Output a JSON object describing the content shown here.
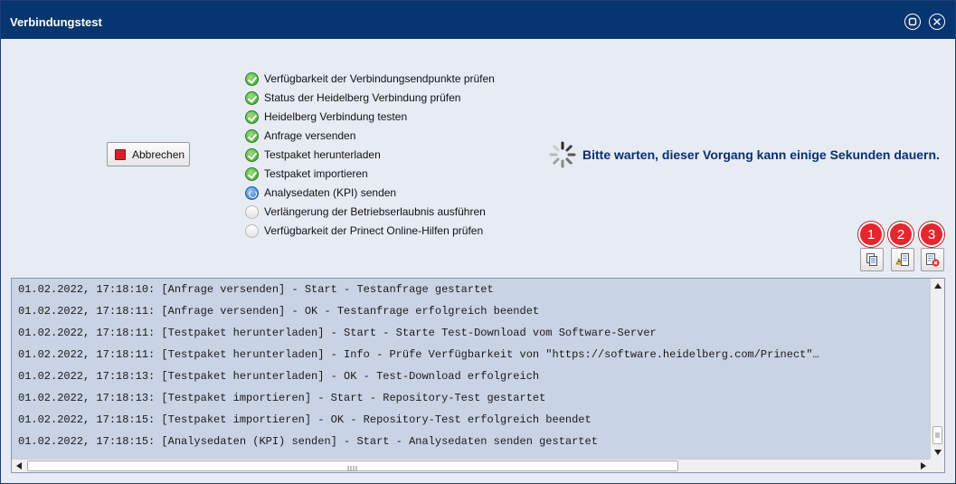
{
  "window": {
    "title": "Verbindungstest"
  },
  "cancel_button": {
    "label": "Abbrechen"
  },
  "steps": [
    {
      "label": "Verfügbarkeit der Verbindungsendpunkte prüfen",
      "status": "done"
    },
    {
      "label": "Status der Heidelberg Verbindung prüfen",
      "status": "done"
    },
    {
      "label": "Heidelberg Verbindung testen",
      "status": "done"
    },
    {
      "label": "Anfrage versenden",
      "status": "done"
    },
    {
      "label": "Testpaket herunterladen",
      "status": "done"
    },
    {
      "label": "Testpaket importieren",
      "status": "done"
    },
    {
      "label": "Analysedaten (KPI) senden",
      "status": "running"
    },
    {
      "label": "Verlängerung der Betriebserlaubnis ausführen",
      "status": "pending"
    },
    {
      "label": "Verfügbarkeit der Prinect Online-Hilfen prüfen",
      "status": "pending"
    }
  ],
  "wait_message": "Bitte warten, dieser Vorgang kann einige Sekunden dauern.",
  "badges": [
    "1",
    "2",
    "3"
  ],
  "action_icons": [
    "copy-log-icon",
    "log-details-icon",
    "clear-log-icon"
  ],
  "log": [
    "01.02.2022, 17:18:10: [Anfrage versenden] - Start - Testanfrage gestartet",
    "01.02.2022, 17:18:11: [Anfrage versenden] - OK - Testanfrage erfolgreich beendet",
    "01.02.2022, 17:18:11: [Testpaket herunterladen] - Start - Starte Test-Download vom Software-Server",
    "01.02.2022, 17:18:11: [Testpaket herunterladen] - Info - Prüfe Verfügbarkeit von \"https://software.heidelberg.com/Prinect\"…",
    "01.02.2022, 17:18:13: [Testpaket herunterladen] - OK - Test-Download erfolgreich",
    "01.02.2022, 17:18:13: [Testpaket importieren] - Start - Repository-Test gestartet",
    "01.02.2022, 17:18:15: [Testpaket importieren] - OK - Repository-Test erfolgreich beendet",
    "01.02.2022, 17:18:15: [Analysedaten (KPI) senden] - Start - Analysedaten senden gestartet"
  ],
  "colors": {
    "titlebar": "#07356f",
    "window_bg": "#e6ebf4",
    "log_bg": "#c8d3e4",
    "badge": "#e5262f",
    "wait_text": "#0a2f6e"
  }
}
